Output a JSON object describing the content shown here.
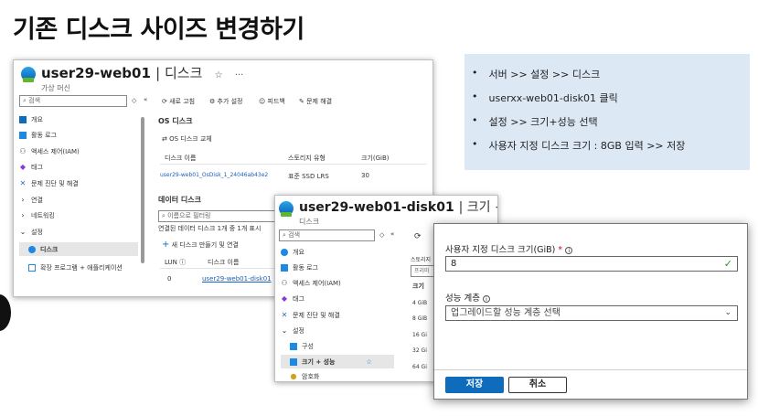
{
  "slide": {
    "title": "기존 디스크 사이즈 변경하기"
  },
  "vm_window": {
    "resource_name": "user29-web01",
    "page_name": "디스크",
    "resource_type": "가상 머신",
    "star": "☆",
    "more": "···",
    "search_placeholder": "검색",
    "collapse": "«",
    "toolbar": [
      "새로 고침",
      "추가 설정",
      "피드백",
      "문제 해결"
    ],
    "sidebar": [
      "개요",
      "활동 로그",
      "액세스 제어(IAM)",
      "태그",
      "문제 진단 및 해결",
      "연결",
      "네트워킹",
      "설정",
      "디스크",
      "확장 프로그램 + 애플리케이션"
    ],
    "os_disk_title": "OS 디스크",
    "swap_os": "OS 디스크 교체",
    "os_cols": [
      "디스크 이름",
      "스토리지 유형",
      "크기(GiB)"
    ],
    "os_row": {
      "name": "user29-web01_OsDisk_1_24046ab43e2",
      "type": "표준 SSD LRS",
      "size": "30"
    },
    "data_disk_title": "데이터 디스크",
    "filter_placeholder": "이름으로 필터링",
    "data_count": "연결된 데이터 디스크 1개 중 1개 표시",
    "add_disk": "새 디스크 만들기 및 연결",
    "data_cols": [
      "LUN",
      "디스크 이름"
    ],
    "data_row": {
      "lun": "0",
      "name": "user29-web01-disk01"
    }
  },
  "disk_window": {
    "resource_name": "user29-web01-disk01",
    "page_name": "크기 + 성능",
    "resource_type": "디스크",
    "star": "☆",
    "more": "···",
    "search_placeholder": "검색",
    "collapse": "«",
    "sidebar": [
      "개요",
      "활동 로그",
      "액세스 제어(IAM)",
      "태그",
      "문제 진단 및 해결",
      "설정",
      "구성",
      "크기 + 성능",
      "암호화"
    ],
    "storage_label": "스토리지",
    "storage_value": "프리미",
    "size_col": "크기",
    "sizes": [
      "4 GiB",
      "8 GiB",
      "16 Gi",
      "32 Gi",
      "64 Gi"
    ]
  },
  "dialog": {
    "size_label": "사용자 지정 디스크 크기(GiB)",
    "required_mark": "*",
    "size_value": "8",
    "tier_label": "성능 계층",
    "tier_placeholder": "업그레이드할 성능 계층 선택",
    "save": "저장",
    "cancel": "취소"
  },
  "notes": [
    "서버 >> 설정 >> 디스크",
    "userxx-web01-disk01 클릭",
    "설정 >> 크기+성능 선택",
    "사용자 지정 디스크 크기 : 8GB 입력 >> 저장"
  ]
}
